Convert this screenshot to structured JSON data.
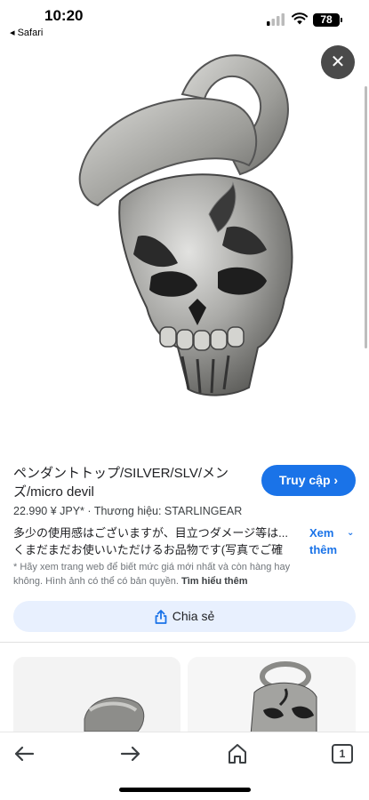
{
  "status_bar": {
    "time": "10:20",
    "back_app": "◂ Safari",
    "battery": "78"
  },
  "product": {
    "title_line1": "ペンダントトップ/SILVER/SLV/メン",
    "title_line2": "ズ/micro devil",
    "visit_label": "Truy cập",
    "price": "22.990 ¥ JPY*",
    "separator": "·",
    "brand": "Thương hiệu: STARLINGEAR",
    "description_line1": "多少の使用感はございますが、目立つダメージ等は...",
    "description_line2": "くまだまだお使いいただけるお品物です(写真でご確",
    "more_label": "Xem thêm",
    "disclaimer": "* Hãy xem trang web để biết mức giá mới nhất và còn hàng hay không. Hình ảnh có thể có bản quyền.",
    "learn_more": "Tìm hiểu thêm",
    "share_label": "Chia sẻ"
  },
  "toolbar": {
    "tab_count": "1"
  },
  "icons": {
    "close": "close-icon",
    "back": "back-arrow-icon",
    "forward": "forward-arrow-icon",
    "home": "home-icon",
    "tabs": "tabs-icon",
    "share": "share-icon"
  },
  "colors": {
    "accent": "#1a73e8",
    "share_bg": "#e8f0fe"
  }
}
